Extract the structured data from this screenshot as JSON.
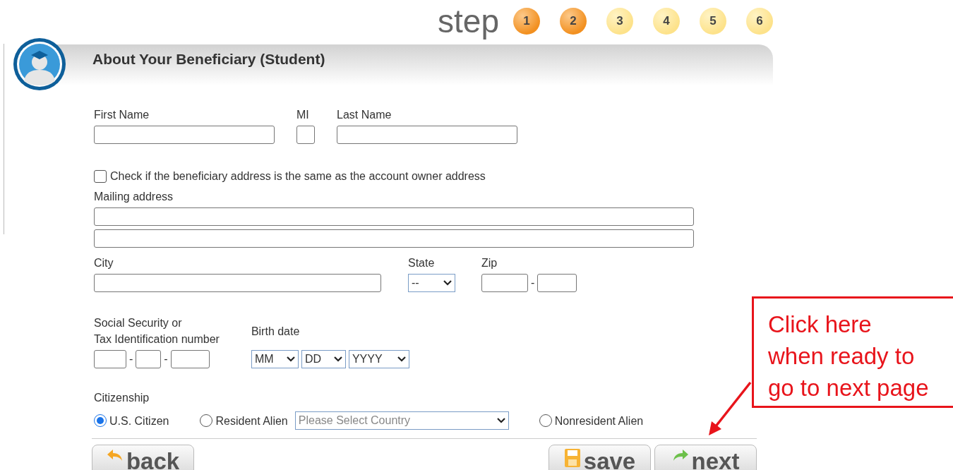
{
  "steps": {
    "label": "step",
    "items": [
      {
        "number": "1",
        "completed": true
      },
      {
        "number": "2",
        "completed": true
      },
      {
        "number": "3",
        "completed": false
      },
      {
        "number": "4",
        "completed": false
      },
      {
        "number": "5",
        "completed": false
      },
      {
        "number": "6",
        "completed": false
      }
    ]
  },
  "section": {
    "title": "About Your Beneficiary (Student)"
  },
  "name_fields": [
    {
      "label": "First Name"
    },
    {
      "label": "MI"
    },
    {
      "label": "Last Name"
    }
  ],
  "same_address": {
    "label": "Check if the beneficiary address is the same as the account owner address",
    "checked": false
  },
  "mailing_address": {
    "label": "Mailing address"
  },
  "city": {
    "label": "City"
  },
  "state": {
    "label": "State",
    "value": "--"
  },
  "zip": {
    "label": "Zip",
    "separator": "-"
  },
  "ssn": {
    "label": "Social Security or\nTax Identification number",
    "separators": [
      "-",
      "-"
    ]
  },
  "birth_date": {
    "label": "Birth date",
    "selects": [
      "MM",
      "DD",
      "YYYY"
    ]
  },
  "citizenship": {
    "label": "Citizenship",
    "country_placeholder": "Please Select Country",
    "options": [
      {
        "label": "U.S. Citizen",
        "selected": true
      },
      {
        "label": "Resident Alien",
        "selected": false
      },
      {
        "label": "Nonresident Alien",
        "selected": false
      }
    ]
  },
  "buttons": [
    {
      "kind": "back",
      "label": "back"
    },
    {
      "kind": "save",
      "label": "save"
    },
    {
      "kind": "next",
      "label": "next"
    }
  ],
  "callout": {
    "text": "Click here\nwhen ready to\ngo to next page"
  }
}
